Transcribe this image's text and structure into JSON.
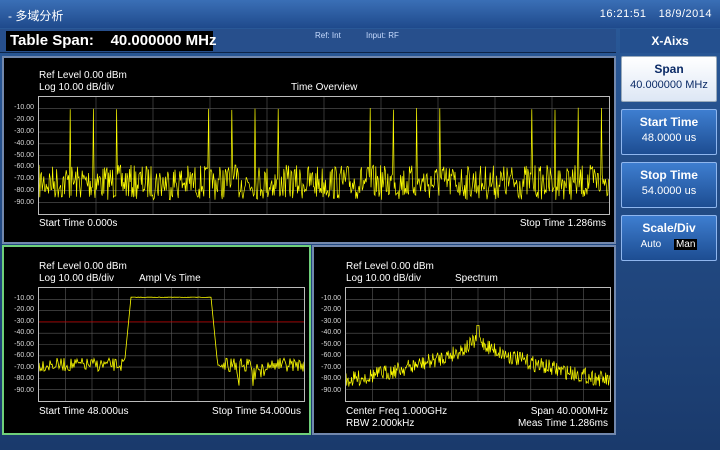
{
  "titlebar": {
    "title": "- 多域分析",
    "time": "16:21:51",
    "date": "18/9/2014"
  },
  "infobar": {
    "span_label": "Table Span:",
    "span_value": "40.000000 MHz",
    "ref_mode": "Ref: Int",
    "input": "Input: RF"
  },
  "sidebar": {
    "header": "X-Aixs",
    "keys": [
      {
        "label": "Span",
        "value": "40.000000 MHz",
        "active": true
      },
      {
        "label": "Start Time",
        "value": "48.0000 us",
        "active": false
      },
      {
        "label": "Stop Time",
        "value": "54.0000 us",
        "active": false
      },
      {
        "label": "Scale/Div",
        "options": [
          "Auto",
          "Man"
        ],
        "selected": "Man",
        "active": false
      }
    ]
  },
  "y_ticks": [
    "-10.00",
    "-20.00",
    "-30.00",
    "-40.00",
    "-50.00",
    "-60.00",
    "-70.00",
    "-80.00",
    "-90.00"
  ],
  "overview": {
    "ref_level": "Ref Level 0.00 dBm",
    "scale": "Log 10.00 dB/div",
    "title": "Time Overview",
    "start": "Start Time 0.000s",
    "stop": "Stop Time 1.286ms"
  },
  "ampl": {
    "ref_level": "Ref Level 0.00 dBm",
    "scale": "Log 10.00 dB/div",
    "title": "Ampl Vs Time",
    "start": "Start Time 48.000us",
    "stop": "Stop Time 54.000us"
  },
  "spectrum": {
    "ref_level": "Ref Level 0.00 dBm",
    "scale": "Log 10.00 dB/div",
    "title": "Spectrum",
    "center": "Center Freq 1.000GHz",
    "span": "Span 40.000MHz",
    "rbw": "RBW 2.000kHz",
    "meas": "Meas Time 1.286ms"
  },
  "colors": {
    "trace": "#ffff00",
    "threshold": "#c00000",
    "grid": "#5a5a5a",
    "panel_border": "#7288ad",
    "selected_border": "#6fd07a"
  }
}
